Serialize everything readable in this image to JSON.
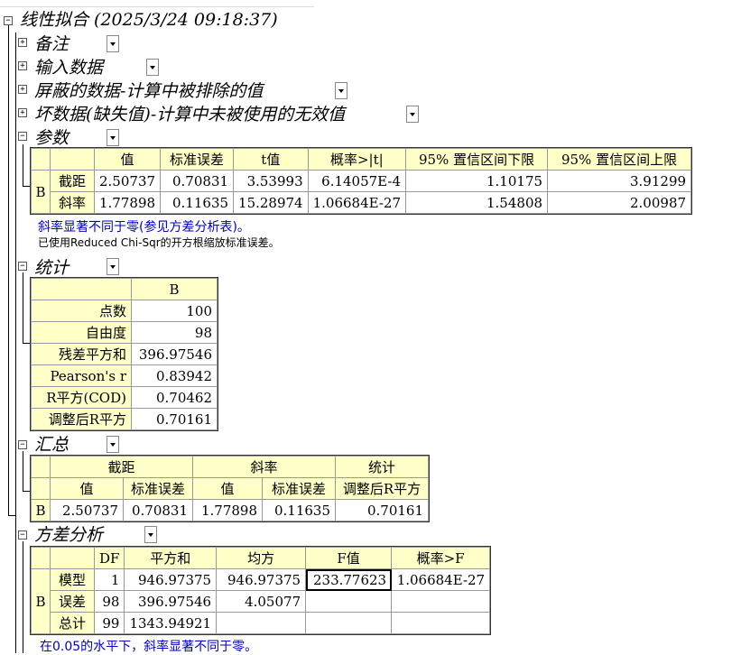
{
  "title": "线性拟合 (2025/3/24 09:18:37)",
  "sections": {
    "notes": "备注",
    "input": "输入数据",
    "masked": "屏蔽的数据-计算中被排除的值",
    "bad": "坏数据(缺失值)-计算中未被使用的无效值",
    "params": "参数",
    "stats": "统计",
    "summary": "汇总",
    "anova": "方差分析"
  },
  "params_table": {
    "headers": [
      "值",
      "标准误差",
      "t值",
      "概率>|t|",
      "95% 置信区间下限",
      "95% 置信区间上限"
    ],
    "group": "B",
    "rows": [
      {
        "label": "截距",
        "cells": [
          "2.50737",
          "0.70831",
          "3.53993",
          "6.14057E-4",
          "1.10175",
          "3.91299"
        ]
      },
      {
        "label": "斜率",
        "cells": [
          "1.77898",
          "0.11635",
          "15.28974",
          "1.06684E-27",
          "1.54808",
          "2.00987"
        ]
      }
    ]
  },
  "params_note1": "斜率显著不同于零(参见方差分析表)。",
  "params_note2": "已使用Reduced Chi-Sqr的开方根缩放标准误差。",
  "stats_table": {
    "header": "B",
    "rows": [
      {
        "label": "点数",
        "value": "100"
      },
      {
        "label": "自由度",
        "value": "98"
      },
      {
        "label": "残差平方和",
        "value": "396.97546"
      },
      {
        "label": "Pearson's r",
        "value": "0.83942"
      },
      {
        "label": "R平方(COD)",
        "value": "0.70462"
      },
      {
        "label": "调整后R平方",
        "value": "0.70161"
      }
    ]
  },
  "summary_table": {
    "groups": [
      "截距",
      "斜率",
      "统计"
    ],
    "subheaders": [
      "值",
      "标准误差",
      "值",
      "标准误差",
      "调整后R平方"
    ],
    "row_label": "B",
    "values": [
      "2.50737",
      "0.70831",
      "1.77898",
      "0.11635",
      "0.70161"
    ]
  },
  "anova_table": {
    "headers": [
      "DF",
      "平方和",
      "均方",
      "F值",
      "概率>F"
    ],
    "group": "B",
    "rows": [
      {
        "label": "模型",
        "cells": [
          "1",
          "946.97375",
          "946.97375",
          "233.77623",
          "1.06684E-27"
        ]
      },
      {
        "label": "误差",
        "cells": [
          "98",
          "396.97546",
          "4.05077",
          "",
          ""
        ]
      },
      {
        "label": "总计",
        "cells": [
          "99",
          "1343.94921",
          "",
          "",
          ""
        ]
      }
    ]
  },
  "anova_note": "在0.05的水平下，斜率显著不同于零。"
}
